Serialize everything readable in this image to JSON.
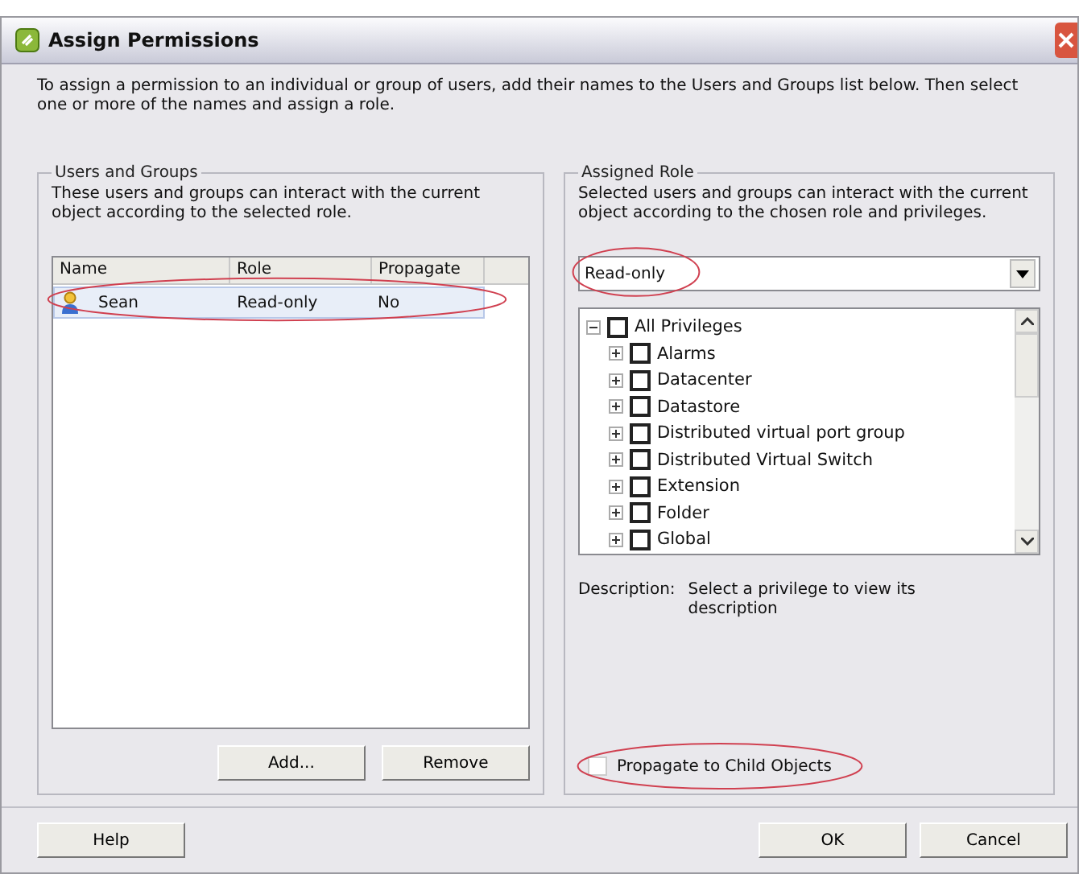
{
  "window": {
    "title": "Assign Permissions"
  },
  "intro": "To assign a permission to an individual or group of users, add their names to the Users and Groups list below. Then select one or more of the names and assign a role.",
  "users_and_groups": {
    "title": "Users and Groups",
    "description": "These users and groups can interact with the current object according to the selected role.",
    "columns": [
      "Name",
      "Role",
      "Propagate"
    ],
    "rows": [
      {
        "name": "Sean",
        "role": "Read-only",
        "propagate": "No",
        "selected": true
      }
    ],
    "buttons": [
      "Add...",
      "Remove"
    ]
  },
  "assigned_role": {
    "title": "Assigned Role",
    "description": "Selected users and groups can interact with the current object according to the chosen role and privileges.",
    "role_dropdown": {
      "value": "Read-only"
    },
    "privileges": [
      {
        "label": "All Privileges",
        "checked": false,
        "expanded": true,
        "children": [
          {
            "label": "Alarms",
            "checked": false,
            "expanded": false
          },
          {
            "label": "Datacenter",
            "checked": false,
            "expanded": false
          },
          {
            "label": "Datastore",
            "checked": false,
            "expanded": false
          },
          {
            "label": "Distributed virtual port group",
            "checked": false,
            "expanded": false
          },
          {
            "label": "Distributed Virtual Switch",
            "checked": false,
            "expanded": false
          },
          {
            "label": "Extension",
            "checked": false,
            "expanded": false
          },
          {
            "label": "Folder",
            "checked": false,
            "expanded": false
          },
          {
            "label": "Global",
            "checked": false,
            "expanded": false
          }
        ]
      }
    ],
    "description_label": "Description:",
    "description_text": "Select a privilege to view its description",
    "propagate": {
      "label": "Propagate to Child Objects",
      "checked": false
    }
  },
  "footer_buttons": [
    "Help",
    "OK",
    "Cancel"
  ]
}
